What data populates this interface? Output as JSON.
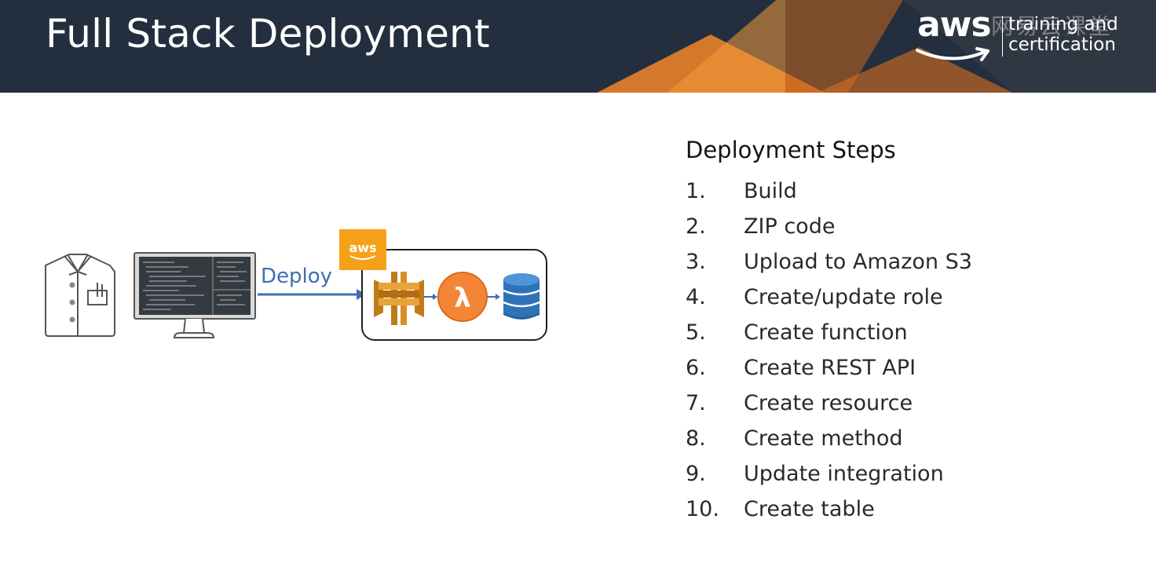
{
  "header": {
    "title": "Full Stack Deployment",
    "logo_text": "aws",
    "logo_line1": "training and",
    "logo_line2": "certification",
    "watermark": "网易云课堂",
    "color_bg": "#232f3e",
    "color_accent": "#e47911"
  },
  "diagram": {
    "deploy_label": "Deploy",
    "aws_badge": "aws",
    "icons": [
      "developer-shirt-icon",
      "monitor-code-icon",
      "api-gateway-icon",
      "lambda-icon",
      "dynamodb-icon"
    ],
    "arrow_color": "#3f6eb5",
    "service_orange": "#f58536"
  },
  "steps": {
    "title": "Deployment Steps",
    "items": [
      {
        "num": "1.",
        "label": "Build"
      },
      {
        "num": "2.",
        "label": "ZIP code"
      },
      {
        "num": "3.",
        "label": "Upload to Amazon S3"
      },
      {
        "num": "4.",
        "label": "Create/update role"
      },
      {
        "num": "5.",
        "label": "Create function"
      },
      {
        "num": "6.",
        "label": "Create REST API"
      },
      {
        "num": "7.",
        "label": "Create resource"
      },
      {
        "num": "8.",
        "label": "Create method"
      },
      {
        "num": "9.",
        "label": "Update integration"
      },
      {
        "num": "10.",
        "label": "Create table"
      }
    ]
  }
}
